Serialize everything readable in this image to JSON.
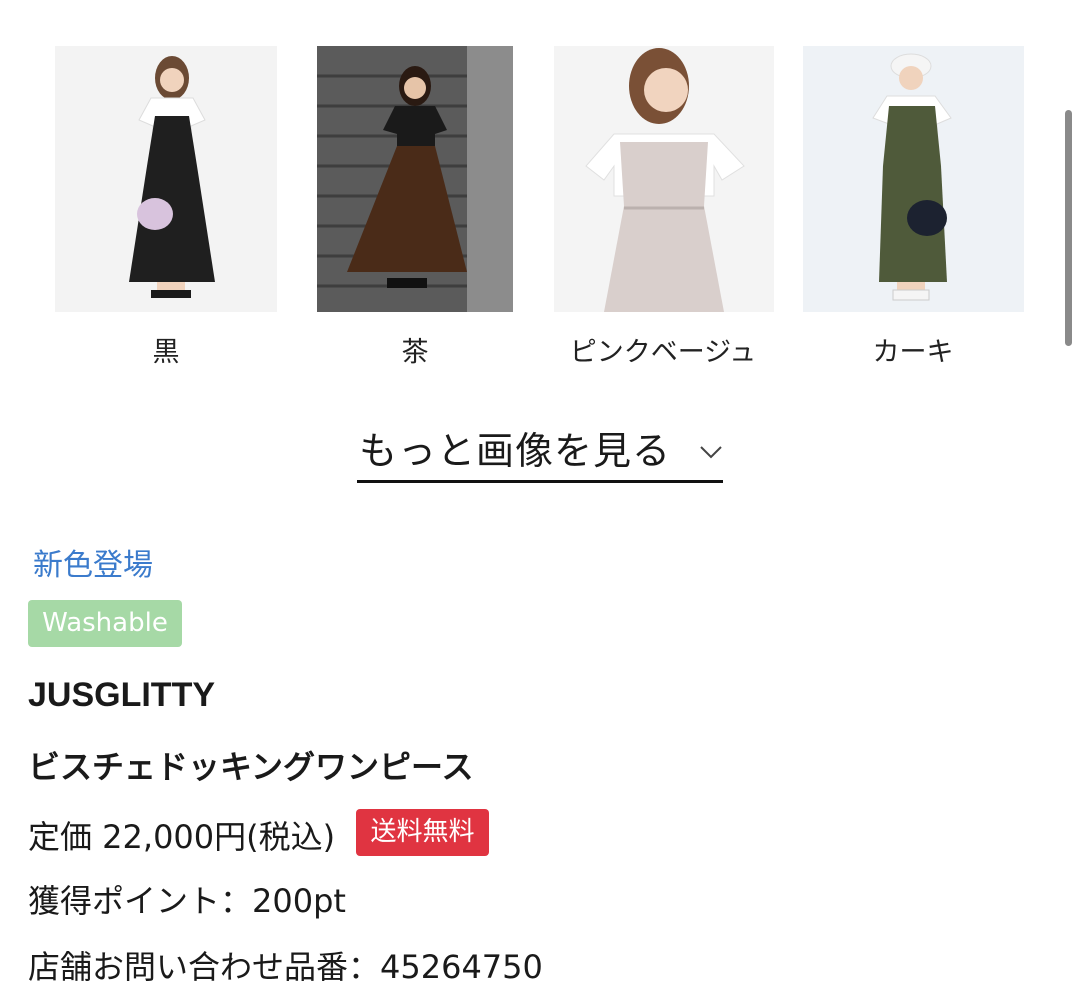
{
  "colors": [
    {
      "label": "黒",
      "dress_color": "#1f1f1f",
      "bg_color": "#f3f3f3"
    },
    {
      "label": "茶",
      "dress_color": "#4a2b18",
      "bg_color": "#5b5b5b"
    },
    {
      "label": "ピンクベージュ",
      "dress_color": "#d9cfcc",
      "bg_color": "#f4f4f4"
    },
    {
      "label": "カーキ",
      "dress_color": "#4f5a3a",
      "bg_color": "#eef2f6"
    }
  ],
  "more_images": {
    "label": "もっと画像を見る",
    "icon": "chevron-down-icon"
  },
  "new_color_label": "新色登場",
  "washable_badge": "Washable",
  "brand": "JUSGLITTY",
  "product_name": "ビスチェドッキングワンピース",
  "price_text": "定価 22,000円(税込)",
  "free_shipping_badge": "送料無料",
  "points_text": "獲得ポイント：200pt",
  "inquiry_code_text": "店舗お問い合わせ品番：45264750",
  "accent_colors": {
    "link": "#3b7bcc",
    "washable": "#a6d9a6",
    "shipping": "#e03441"
  }
}
